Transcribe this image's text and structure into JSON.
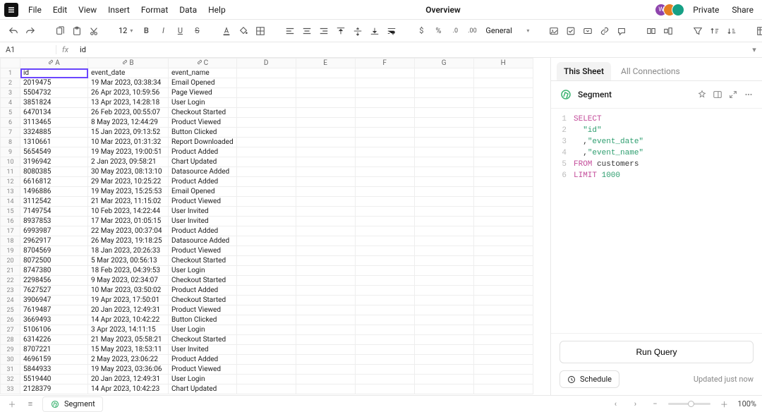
{
  "menus": [
    "File",
    "Edit",
    "View",
    "Insert",
    "Format",
    "Data",
    "Help"
  ],
  "title": "Overview",
  "top_right": {
    "private": "Private",
    "share": "Share"
  },
  "avatars": [
    {
      "initial": "W",
      "bg": "#8e44ad"
    },
    {
      "initial": "",
      "bg": "#e67e22",
      "img": true
    },
    {
      "initial": "",
      "bg": "#16a085",
      "img": true
    }
  ],
  "toolbar": {
    "fontsize": "12",
    "number_format": "General",
    "chart": "Chart",
    "pivot": "Pivot Table",
    "connections": "Connections"
  },
  "formula_bar": {
    "cell": "A1",
    "fx": "fx",
    "value": "id"
  },
  "columns_linked": [
    "A",
    "B",
    "C"
  ],
  "columns_plain": [
    "D",
    "E",
    "F",
    "G",
    "H"
  ],
  "headers": [
    "id",
    "event_date",
    "event_name"
  ],
  "rows": [
    [
      "2019475",
      "19 Mar 2023, 03:38:34",
      "Email Opened"
    ],
    [
      "5504732",
      "26 Apr 2023, 10:59:56",
      "Page Viewed"
    ],
    [
      "3851824",
      "13 Apr 2023, 14:28:18",
      "User Login"
    ],
    [
      "6470134",
      "26 Feb 2023, 00:55:07",
      "Checkout Started"
    ],
    [
      "3113465",
      "8 May 2023, 12:44:29",
      "Product Viewed"
    ],
    [
      "3324885",
      "15 Jan 2023, 09:13:52",
      "Button Clicked"
    ],
    [
      "1310661",
      "10 Mar 2023, 01:31:32",
      "Report Downloaded"
    ],
    [
      "5654549",
      "19 May 2023, 19:00:51",
      "Product Added"
    ],
    [
      "3196942",
      "2 Jan 2023, 09:58:21",
      "Chart Updated"
    ],
    [
      "8080385",
      "30 May 2023, 08:13:10",
      "Datasource Added"
    ],
    [
      "6616812",
      "29 Mar 2023, 10:25:22",
      "Product Added"
    ],
    [
      "1496886",
      "19 May 2023, 15:25:53",
      "Email Opened"
    ],
    [
      "3112542",
      "21 Mar 2023, 11:15:02",
      "Product Viewed"
    ],
    [
      "7149754",
      "10 Feb 2023, 14:22:44",
      "User Invited"
    ],
    [
      "8937853",
      "17 Mar 2023, 01:05:15",
      "User Invited"
    ],
    [
      "6993987",
      "22 May 2023, 00:37:04",
      "Product Added"
    ],
    [
      "2962917",
      "26 May 2023, 19:18:25",
      "Datasource Added"
    ],
    [
      "8704569",
      "18 Jan 2023, 20:26:33",
      "Product Viewed"
    ],
    [
      "8072500",
      "5 Mar 2023, 00:56:13",
      "Checkout Started"
    ],
    [
      "8747380",
      "18 Feb 2023, 04:39:53",
      "User Login"
    ],
    [
      "2298456",
      "9 May 2023, 02:34:07",
      "Checkout Started"
    ],
    [
      "7627527",
      "10 Mar 2023, 03:50:02",
      "Product Added"
    ],
    [
      "3906947",
      "19 Apr 2023, 17:50:01",
      "Checkout Started"
    ],
    [
      "7619487",
      "20 Jan 2023, 12:49:31",
      "Product Viewed"
    ],
    [
      "3669493",
      "14 Apr 2023, 10:42:22",
      "Button Clicked"
    ],
    [
      "5106106",
      "3 Apr 2023, 14:11:15",
      "User Login"
    ],
    [
      "6314226",
      "21 May 2023, 05:58:21",
      "Checkout Started"
    ],
    [
      "8707221",
      "15 May 2023, 18:53:11",
      "User Invited"
    ],
    [
      "4696159",
      "2 May 2023, 23:06:22",
      "Product Added"
    ],
    [
      "5844933",
      "19 May 2023, 03:36:06",
      "Product Viewed"
    ],
    [
      "5519440",
      "20 Jan 2023, 12:49:31",
      "User Login"
    ],
    [
      "2128379",
      "14 Apr 2023, 10:42:23",
      "Chart Updated"
    ]
  ],
  "panel": {
    "tabs": [
      "This Sheet",
      "All Connections"
    ],
    "title": "Segment",
    "run": "Run Query",
    "schedule": "Schedule",
    "updated": "Updated just now",
    "sql": [
      {
        "tokens": [
          [
            "kw",
            "SELECT"
          ]
        ]
      },
      {
        "tokens": [
          [
            "ident",
            "  "
          ],
          [
            "str",
            "\"id\""
          ]
        ]
      },
      {
        "tokens": [
          [
            "ident",
            "  ,"
          ],
          [
            "str",
            "\"event_date\""
          ]
        ]
      },
      {
        "tokens": [
          [
            "ident",
            "  ,"
          ],
          [
            "str",
            "\"event_name\""
          ]
        ]
      },
      {
        "tokens": [
          [
            "kw",
            "FROM "
          ],
          [
            "ident",
            "customers"
          ]
        ]
      },
      {
        "tokens": [
          [
            "kw",
            "LIMIT "
          ],
          [
            "num",
            "1000"
          ]
        ]
      }
    ]
  },
  "bottom": {
    "sheet": "Segment",
    "zoom": "100%"
  }
}
